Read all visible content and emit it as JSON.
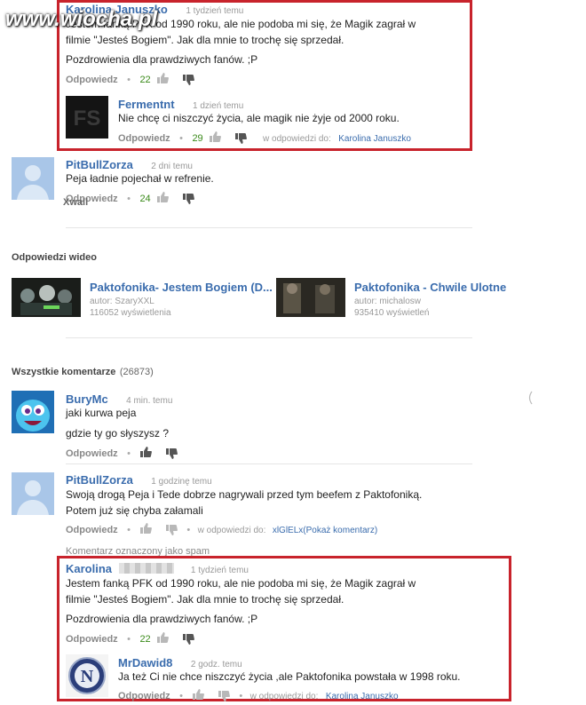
{
  "watermark": "www.wiocha.pl",
  "xwall": "Xwall",
  "common": {
    "reply": "Odpowiedz",
    "in_reply_to": "w odpowiedzi do:"
  },
  "top": {
    "c1": {
      "name": "Karolina Januszko",
      "time": "1 tydzień temu",
      "text1": "Jestem fanką PFK od 1990 roku, ale nie podoba mi się, że Magik zagrał w",
      "text2": "filmie \"Jesteś Bogiem\". Jak dla mnie to trochę się sprzedał.",
      "text3": "Pozdrowienia dla prawdziwych fanów. ;P",
      "votes": "22"
    },
    "r1": {
      "name": "Fermentnt",
      "time": "1 dzień temu",
      "text": "Nie chcę ci niszczyć życia, ale magik nie żyje od 2000 roku.",
      "votes": "29",
      "reply_to": "Karolina Januszko"
    }
  },
  "pit1": {
    "name": "PitBullZorza",
    "time": "2 dni temu",
    "text": "Peja ładnie pojechał w refrenie.",
    "votes": "24"
  },
  "videos": {
    "heading": "Odpowiedzi wideo",
    "items": [
      {
        "title": "Paktofonika- Jestem Bogiem (D...",
        "author": "autor: SzaryXXL",
        "views": "116052 wyświetlenia"
      },
      {
        "title": "Paktofonika - Chwile Ulotne",
        "author": "autor: michalosw",
        "views": "935410 wyświetleń"
      }
    ]
  },
  "all": {
    "heading": "Wszystkie komentarze",
    "count": "(26873)"
  },
  "bury": {
    "name": "BuryMc",
    "time": "4 min. temu",
    "text1": "jaki kurwa peja",
    "text2": "gdzie ty go słyszysz ?"
  },
  "pit2": {
    "name": "PitBullZorza",
    "time": "1 godzinę temu",
    "text1": "Swoją drogą Peja i Tede dobrze nagrywali przed tym beefem z Paktofoniką.",
    "text2": "Potem już się chyba załamali",
    "reply_to": "xlGlELx",
    "show": "(Pokaż komentarz)"
  },
  "spam": "Komentarz oznaczony jako spam",
  "bottom": {
    "c1": {
      "name": "Karolina",
      "time": "1 tydzień temu",
      "text1": "Jestem fanką PFK od 1990 roku, ale nie podoba mi się, że Magik zagrał w",
      "text2": "filmie \"Jesteś Bogiem\". Jak dla mnie to trochę się sprzedał.",
      "text3": "Pozdrowienia dla prawdziwych fanów. ;P",
      "votes": "22"
    },
    "r1": {
      "name": "MrDawid8",
      "time": "2 godz. temu",
      "text": "Ja też Ci nie chce niszczyć życia ,ale Paktofonika powstała w 1998 roku.",
      "reply_to": "Karolina Januszko"
    }
  },
  "colors": {
    "highlight_border": "#c8232c",
    "link": "#3a6cad",
    "vote_count": "#3a8a1a"
  }
}
